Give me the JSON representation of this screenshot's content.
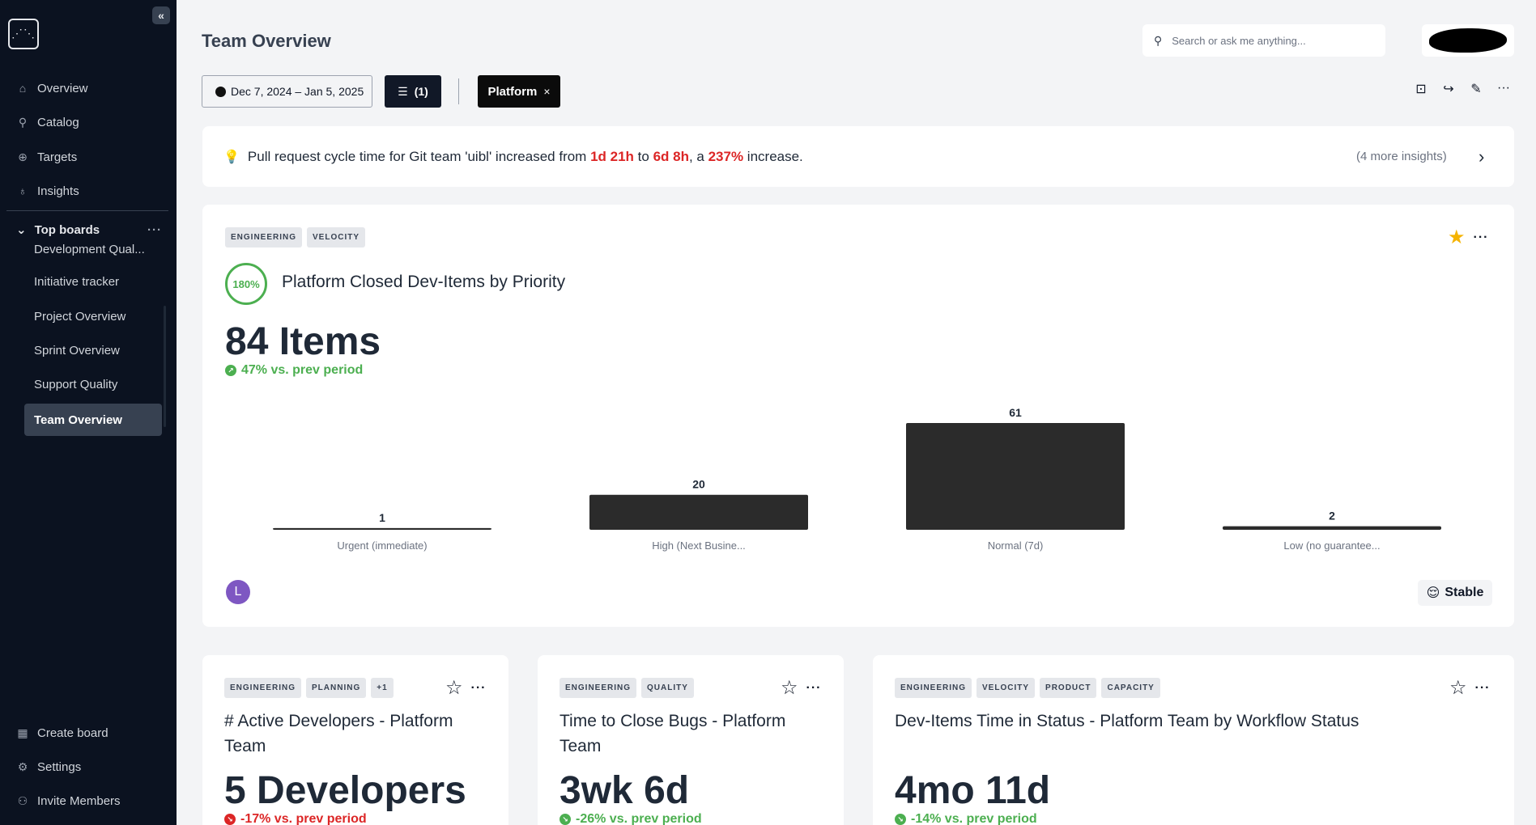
{
  "sidebar": {
    "logo_glyph": "⋰⋱",
    "collapse_glyph": "«",
    "nav": [
      {
        "label": "Overview",
        "icon": "home-icon",
        "glyph": "⌂"
      },
      {
        "label": "Catalog",
        "icon": "search-icon",
        "glyph": "⚲"
      },
      {
        "label": "Targets",
        "icon": "target-icon",
        "glyph": "⊕"
      },
      {
        "label": "Insights",
        "icon": "lightbulb-icon",
        "glyph": "♁"
      }
    ],
    "top_boards_label": "Top boards",
    "top_boards_chevron": "⌄",
    "top_boards_more": "···",
    "boards": [
      {
        "label": "Development Qual..."
      },
      {
        "label": "Initiative tracker"
      },
      {
        "label": "Project Overview"
      },
      {
        "label": "Sprint Overview"
      },
      {
        "label": "Support Quality"
      },
      {
        "label": "Team Overview",
        "active": true
      }
    ],
    "bottom": [
      {
        "label": "Create board",
        "icon": "grid-plus-icon",
        "glyph": "▦"
      },
      {
        "label": "Settings",
        "icon": "gear-icon",
        "glyph": "⚙"
      },
      {
        "label": "Invite Members",
        "icon": "user-plus-icon",
        "glyph": "⚇"
      }
    ]
  },
  "header": {
    "title": "Team Overview",
    "search_placeholder": "Search or ask me anything...",
    "search_glyph": "⚲",
    "date_range": "Dec 7, 2024 – Jan 5, 2025",
    "filter_label": "(1)",
    "filter_glyph": "☰",
    "chip_label": "Platform",
    "chip_close": "×",
    "toolbar_icons": [
      {
        "name": "lock-icon",
        "glyph": "⊡"
      },
      {
        "name": "share-icon",
        "glyph": "↪"
      },
      {
        "name": "edit-icon",
        "glyph": "✎"
      },
      {
        "name": "more-icon",
        "glyph": "···"
      }
    ]
  },
  "insight": {
    "bulb": "💡",
    "text_1": "Pull request cycle time for Git team 'uibl' increased from ",
    "value_1": "1d 21h",
    "text_2": " to ",
    "value_2": "6d 8h",
    "text_3": ", a ",
    "value_3": "237%",
    "text_4": " increase.",
    "more": "(4 more insights)",
    "chevron": "›"
  },
  "main_card": {
    "tags": [
      "ENGINEERING",
      "VELOCITY"
    ],
    "star_glyph": "★",
    "more_glyph": "···",
    "badge": "180%",
    "title": "Platform Closed Dev-Items by Priority",
    "value": "84 Items",
    "delta_glyph": "↗",
    "delta": "47% vs. prev period",
    "owner_initial": "L",
    "status_emoji": "😌",
    "status": "Stable",
    "colors": {
      "bar": "#2b2b2b",
      "accent_green": "#4caf50"
    }
  },
  "chart_data": {
    "type": "bar",
    "categories": [
      "Urgent (immediate)",
      "High (Next Busine...",
      "Normal (7d)",
      "Low (no guarantee..."
    ],
    "values": [
      1,
      20,
      61,
      2
    ],
    "title": "Platform Closed Dev-Items by Priority",
    "xlabel": "",
    "ylabel": "",
    "ylim": [
      0,
      61
    ]
  },
  "cards": [
    {
      "tags": [
        "ENGINEERING",
        "PLANNING",
        "+1"
      ],
      "star_glyph": "☆",
      "more_glyph": "···",
      "title": "# Active Developers - Platform Team",
      "value": "5 Developers",
      "delta_glyph": "↘",
      "delta": "-17% vs. prev period",
      "trend": "down"
    },
    {
      "tags": [
        "ENGINEERING",
        "QUALITY"
      ],
      "star_glyph": "☆",
      "more_glyph": "···",
      "title": "Time to Close Bugs - Platform Team",
      "value": "3wk 6d",
      "delta_glyph": "↘",
      "delta": "-26% vs. prev period",
      "trend": "up"
    },
    {
      "tags": [
        "ENGINEERING",
        "VELOCITY",
        "PRODUCT",
        "CAPACITY"
      ],
      "star_glyph": "☆",
      "more_glyph": "···",
      "title": "Dev-Items Time in Status - Platform Team by Workflow Status",
      "value": "4mo 11d",
      "delta_glyph": "↘",
      "delta": "-14% vs. prev period",
      "trend": "up"
    }
  ]
}
